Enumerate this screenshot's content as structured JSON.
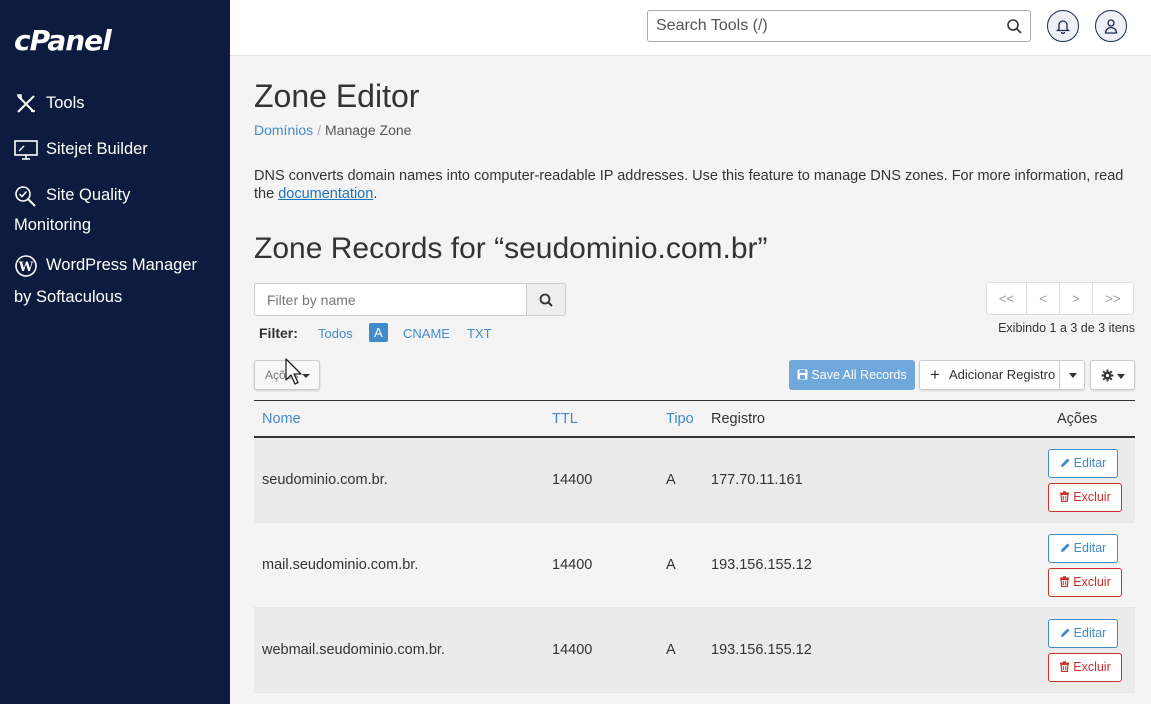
{
  "sidebar": {
    "logo": "cPanel",
    "items": [
      {
        "label": "Tools"
      },
      {
        "label": "Sitejet Builder"
      },
      {
        "label_line1": "Site Quality",
        "label_line2": "Monitoring"
      },
      {
        "label_line1": "WordPress Manager",
        "label_line2": "by Softaculous"
      }
    ]
  },
  "topbar": {
    "search_placeholder": "Search Tools (/)"
  },
  "page": {
    "title": "Zone Editor",
    "breadcrumb": {
      "parent": "Domínios",
      "current": "Manage Zone"
    },
    "description": "DNS converts domain names into computer-readable IP addresses. Use this feature to manage DNS zones. For more information, read the ",
    "description_link": "documentation",
    "description_end": ".",
    "zone_title": "Zone Records for “seudominio.com.br”"
  },
  "filter": {
    "placeholder": "Filter by name",
    "label": "Filter:",
    "options": [
      "Todos",
      "A",
      "CNAME",
      "TXT"
    ],
    "active": "A"
  },
  "pagination": {
    "buttons": [
      "<<",
      "<",
      ">",
      ">>"
    ],
    "info": "Exibindo 1 a 3 de 3 itens"
  },
  "toolbar": {
    "actions_label": "Ações",
    "save_all_label": "Save All Records",
    "add_record_label": "Adicionar Registro"
  },
  "table": {
    "headers": {
      "name": "Nome",
      "ttl": "TTL",
      "type": "Tipo",
      "record": "Registro",
      "actions": "Ações"
    },
    "edit_label": "Editar",
    "delete_label": "Excluir",
    "rows": [
      {
        "name": "seudominio.com.br.",
        "ttl": "14400",
        "type": "A",
        "record": "177.70.11.161"
      },
      {
        "name": "mail.seudominio.com.br.",
        "ttl": "14400",
        "type": "A",
        "record": "193.156.155.12"
      },
      {
        "name": "webmail.seudominio.com.br.",
        "ttl": "14400",
        "type": "A",
        "record": "193.156.155.12"
      }
    ]
  },
  "colors": {
    "sidebar_bg": "#0d1b3e",
    "link": "#428bca",
    "save_button": "#71a8dc",
    "danger": "#c9302c"
  },
  "icons": [
    "tools-icon",
    "monitor-icon",
    "magnify-check-icon",
    "wordpress-icon",
    "search-icon",
    "bell-icon",
    "user-icon",
    "save-icon",
    "plus-icon",
    "gear-icon",
    "pencil-icon",
    "trash-icon"
  ]
}
